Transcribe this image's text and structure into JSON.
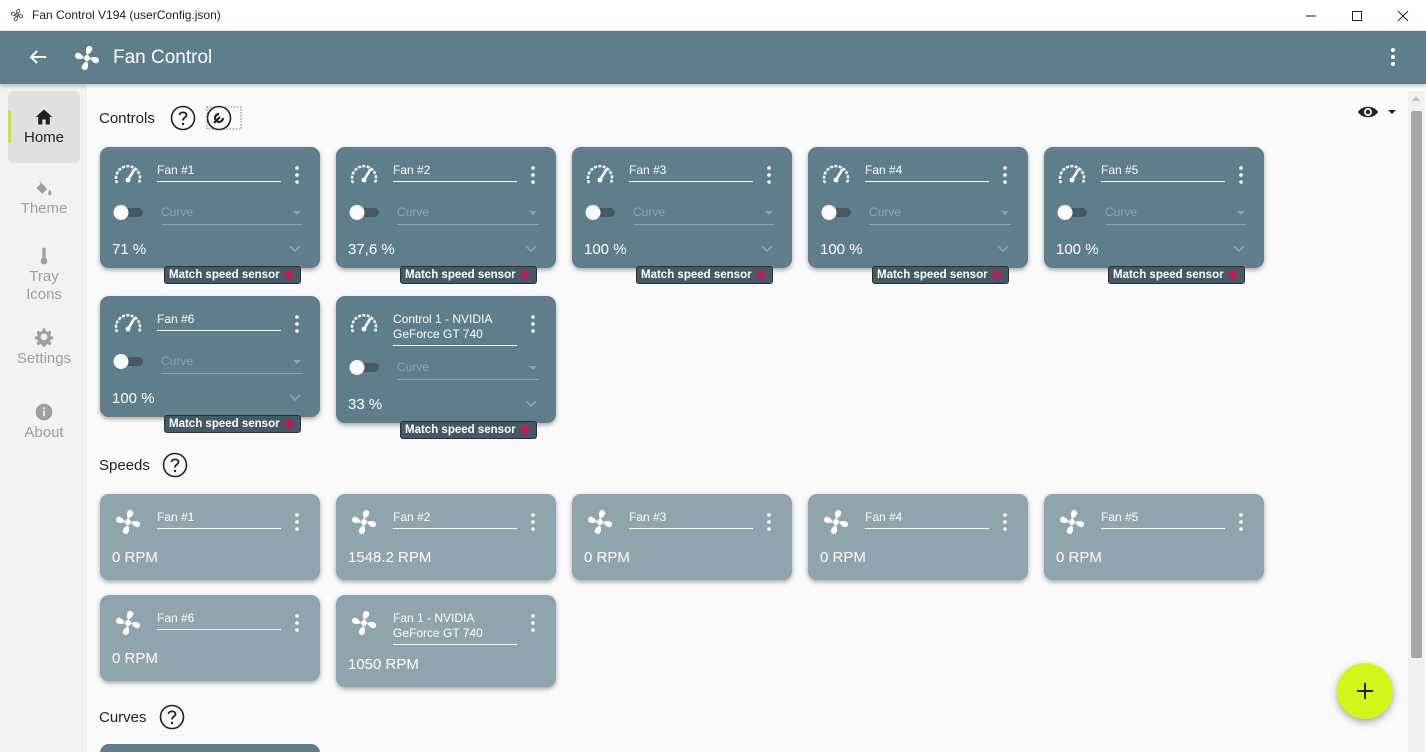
{
  "window": {
    "title": "Fan Control V194 (userConfig.json)"
  },
  "app": {
    "title": "Fan Control"
  },
  "sidebar": {
    "items": [
      {
        "label": "Home",
        "icon": "home-icon",
        "active": true
      },
      {
        "label": "Theme",
        "icon": "paint-bucket-icon"
      },
      {
        "label": "Tray\nIcons",
        "icon": "thermometer-icon"
      },
      {
        "label": "Settings",
        "icon": "gear-icon"
      },
      {
        "label": "About",
        "icon": "info-icon"
      }
    ]
  },
  "sections": {
    "controls": "Controls",
    "speeds": "Speeds",
    "curves": "Curves"
  },
  "controls": [
    {
      "name": "Fan #1",
      "curve_placeholder": "Curve",
      "value": "71 %",
      "badge": "Match speed sensor"
    },
    {
      "name": "Fan #2",
      "curve_placeholder": "Curve",
      "value": "37,6 %",
      "badge": "Match speed sensor"
    },
    {
      "name": "Fan #3",
      "curve_placeholder": "Curve",
      "value": "100 %",
      "badge": "Match speed sensor"
    },
    {
      "name": "Fan #4",
      "curve_placeholder": "Curve",
      "value": "100 %",
      "badge": "Match speed sensor"
    },
    {
      "name": "Fan #5",
      "curve_placeholder": "Curve",
      "value": "100 %",
      "badge": "Match speed sensor"
    },
    {
      "name": "Fan #6",
      "curve_placeholder": "Curve",
      "value": "100 %",
      "badge": "Match speed sensor"
    },
    {
      "name": "Control 1 - NVIDIA GeForce GT 740",
      "curve_placeholder": "Curve",
      "value": "33 %",
      "badge": "Match speed sensor"
    }
  ],
  "speeds": [
    {
      "name": "Fan #1",
      "value": "0 RPM"
    },
    {
      "name": "Fan #2",
      "value": "1548.2 RPM"
    },
    {
      "name": "Fan #3",
      "value": "0 RPM"
    },
    {
      "name": "Fan #4",
      "value": "0 RPM"
    },
    {
      "name": "Fan #5",
      "value": "0 RPM"
    },
    {
      "name": "Fan #6",
      "value": "0 RPM"
    },
    {
      "name": "Fan 1 - NVIDIA GeForce GT 740",
      "value": "1050 RPM"
    }
  ],
  "colors": {
    "header": "#607d8b",
    "control_card": "#607d8b",
    "speed_card": "#90a4ae",
    "accent": "#d4f51a",
    "badge_plus": "#c2185b"
  }
}
